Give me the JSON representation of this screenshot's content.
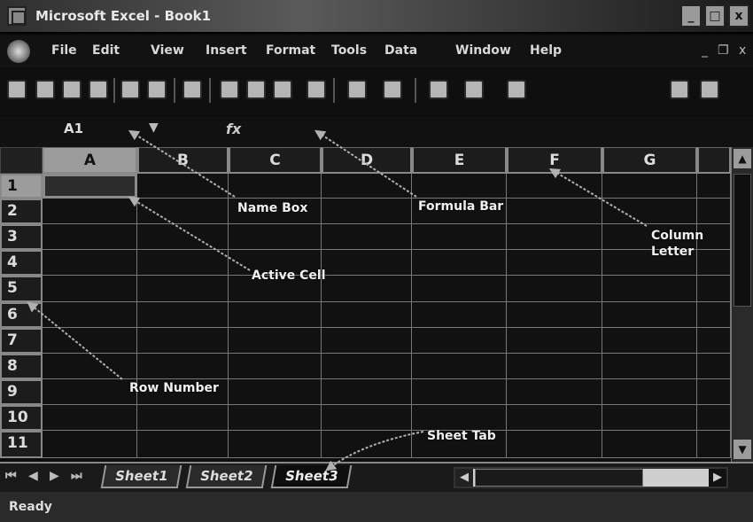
{
  "window": {
    "title": "Microsoft Excel - Book1",
    "controls": {
      "minimize": "_",
      "maximize": "□",
      "close": "x"
    }
  },
  "menu": {
    "items": [
      "File",
      "Edit",
      "View",
      "Insert",
      "Format",
      "Tools",
      "Data",
      "Window",
      "Help"
    ],
    "doc_controls": {
      "minimize": "_",
      "restore": "❐",
      "close": "x"
    }
  },
  "toolbar": {
    "icons": [
      "new-icon",
      "open-icon",
      "save-icon",
      "permission-icon",
      "print-icon",
      "print-preview-icon",
      "spelling-icon",
      "cut-icon",
      "copy-icon",
      "paste-icon",
      "format-painter-icon",
      "undo-icon",
      "redo-icon",
      "hyperlink-icon",
      "autosum-icon",
      "sort-icon",
      "chart-wizard-icon",
      "help-icon"
    ]
  },
  "formula_bar": {
    "name_box_value": "A1",
    "dropdown_glyph": "▼",
    "fx_label": "fx",
    "formula_value": ""
  },
  "grid": {
    "columns": [
      "A",
      "B",
      "C",
      "D",
      "E",
      "F",
      "G"
    ],
    "rows": [
      "1",
      "2",
      "3",
      "4",
      "5",
      "6",
      "7",
      "8",
      "9",
      "10",
      "11"
    ],
    "active_cell": "A1"
  },
  "sheet_tabs": {
    "nav": [
      "⏮",
      "◀",
      "▶",
      "⏭"
    ],
    "tabs": [
      "Sheet1",
      "Sheet2",
      "Sheet3"
    ],
    "active_tab": "Sheet3"
  },
  "status": {
    "text": "Ready"
  },
  "annotations": {
    "name_box": "Name Box",
    "formula_bar": "Formula Bar",
    "column_letter": [
      "Column",
      "Letter"
    ],
    "active_cell": "Active Cell",
    "row_number": "Row Number",
    "sheet_tab": "Sheet Tab"
  },
  "colors": {
    "background": "#0d0d0d",
    "header": "#1c1c1c",
    "active_header": "#9c9c9c",
    "gridline": "#777777",
    "annotation_arrow": "#b0b0b0"
  }
}
